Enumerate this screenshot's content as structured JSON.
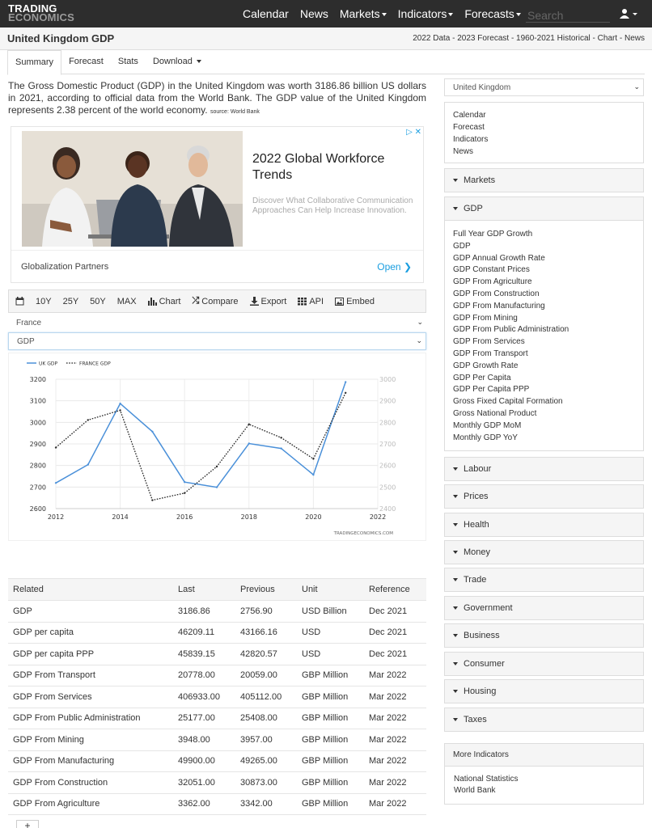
{
  "brand": {
    "line1": "TRADING",
    "line2": "ECONOMICS"
  },
  "nav": {
    "calendar": "Calendar",
    "news": "News",
    "markets": "Markets",
    "indicators": "Indicators",
    "forecasts": "Forecasts",
    "search_placeholder": "Search"
  },
  "header": {
    "title": "United Kingdom GDP",
    "links": "2022 Data - 2023 Forecast - 1960-2021 Historical - Chart - News"
  },
  "tabs": [
    "Summary",
    "Forecast",
    "Stats",
    "Download"
  ],
  "summary": {
    "text": "The Gross Domestic Product (GDP) in the United Kingdom was worth 3186.86 billion US dollars in 2021, according to official data from the World Bank. The GDP value of the United Kingdom represents 2.38 percent of the world economy.",
    "source": "source: World Bank"
  },
  "ad": {
    "title": "2022 Global Workforce Trends",
    "description": "Discover What Collaborative Communication Approaches Can Help Increase Innovation.",
    "brand": "Globalization Partners",
    "cta": "Open"
  },
  "toolbar": {
    "y10": "10Y",
    "y25": "25Y",
    "y50": "50Y",
    "max": "MAX",
    "chart": "Chart",
    "compare": "Compare",
    "export": "Export",
    "api": "API",
    "embed": "Embed"
  },
  "selects": {
    "country": "France",
    "indicator": "GDP"
  },
  "chart_data": {
    "type": "line",
    "x": [
      2012,
      2013,
      2014,
      2015,
      2016,
      2017,
      2018,
      2019,
      2020,
      2021
    ],
    "series": [
      {
        "name": "UK GDP",
        "axis": "left",
        "values": [
          2719,
          2804,
          3087,
          2957,
          2723,
          2699,
          2902,
          2879,
          2757,
          3187
        ]
      },
      {
        "name": "FRANCE GDP",
        "axis": "right",
        "values": [
          2683,
          2811,
          2856,
          2439,
          2472,
          2595,
          2791,
          2729,
          2631,
          2937
        ]
      }
    ],
    "xlim": [
      2012,
      2022
    ],
    "x_ticks": [
      "2012",
      "2014",
      "2016",
      "2018",
      "2020",
      "2022"
    ],
    "ylim_left": [
      2600,
      3200
    ],
    "ylim_right": [
      2400,
      3000
    ],
    "y_ticks_left": [
      "3200",
      "3100",
      "3000",
      "2900",
      "2800",
      "2700",
      "2600"
    ],
    "y_ticks_right": [
      "3000",
      "2900",
      "2800",
      "2700",
      "2600",
      "2500",
      "2400"
    ],
    "legend_position": "top-left",
    "grid": true,
    "watermark": "TRADINGECONOMICS.COM",
    "colors": {
      "uk": "#4a90d9",
      "france": "#222222"
    }
  },
  "related": {
    "headers": [
      "Related",
      "Last",
      "Previous",
      "Unit",
      "Reference"
    ],
    "rows": [
      [
        "GDP",
        "3186.86",
        "2756.90",
        "USD Billion",
        "Dec 2021"
      ],
      [
        "GDP per capita",
        "46209.11",
        "43166.16",
        "USD",
        "Dec 2021"
      ],
      [
        "GDP per capita PPP",
        "45839.15",
        "42820.57",
        "USD",
        "Dec 2021"
      ],
      [
        "GDP From Transport",
        "20778.00",
        "20059.00",
        "GBP Million",
        "Mar 2022"
      ],
      [
        "GDP From Services",
        "406933.00",
        "405112.00",
        "GBP Million",
        "Mar 2022"
      ],
      [
        "GDP From Public Administration",
        "25177.00",
        "25408.00",
        "GBP Million",
        "Mar 2022"
      ],
      [
        "GDP From Mining",
        "3948.00",
        "3957.00",
        "GBP Million",
        "Mar 2022"
      ],
      [
        "GDP From Manufacturing",
        "49900.00",
        "49265.00",
        "GBP Million",
        "Mar 2022"
      ],
      [
        "GDP From Construction",
        "32051.00",
        "30873.00",
        "GBP Million",
        "Mar 2022"
      ],
      [
        "GDP From Agriculture",
        "3362.00",
        "3342.00",
        "GBP Million",
        "Mar 2022"
      ]
    ],
    "more": "+"
  },
  "sidebar": {
    "country": "United Kingdom",
    "links": [
      "Calendar",
      "Forecast",
      "Indicators",
      "News"
    ],
    "markets": "Markets",
    "gdp": "GDP",
    "gdp_items": [
      "Full Year GDP Growth",
      "GDP",
      "GDP Annual Growth Rate",
      "GDP Constant Prices",
      "GDP From Agriculture",
      "GDP From Construction",
      "GDP From Manufacturing",
      "GDP From Mining",
      "GDP From Public Administration",
      "GDP From Services",
      "GDP From Transport",
      "GDP Growth Rate",
      "GDP Per Capita",
      "GDP Per Capita PPP",
      "Gross Fixed Capital Formation",
      "Gross National Product",
      "Monthly GDP MoM",
      "Monthly GDP YoY"
    ],
    "categories": [
      "Labour",
      "Prices",
      "Health",
      "Money",
      "Trade",
      "Government",
      "Business",
      "Consumer",
      "Housing",
      "Taxes"
    ],
    "more_indicators": "More Indicators",
    "more_links": [
      "National Statistics",
      "World Bank"
    ]
  }
}
